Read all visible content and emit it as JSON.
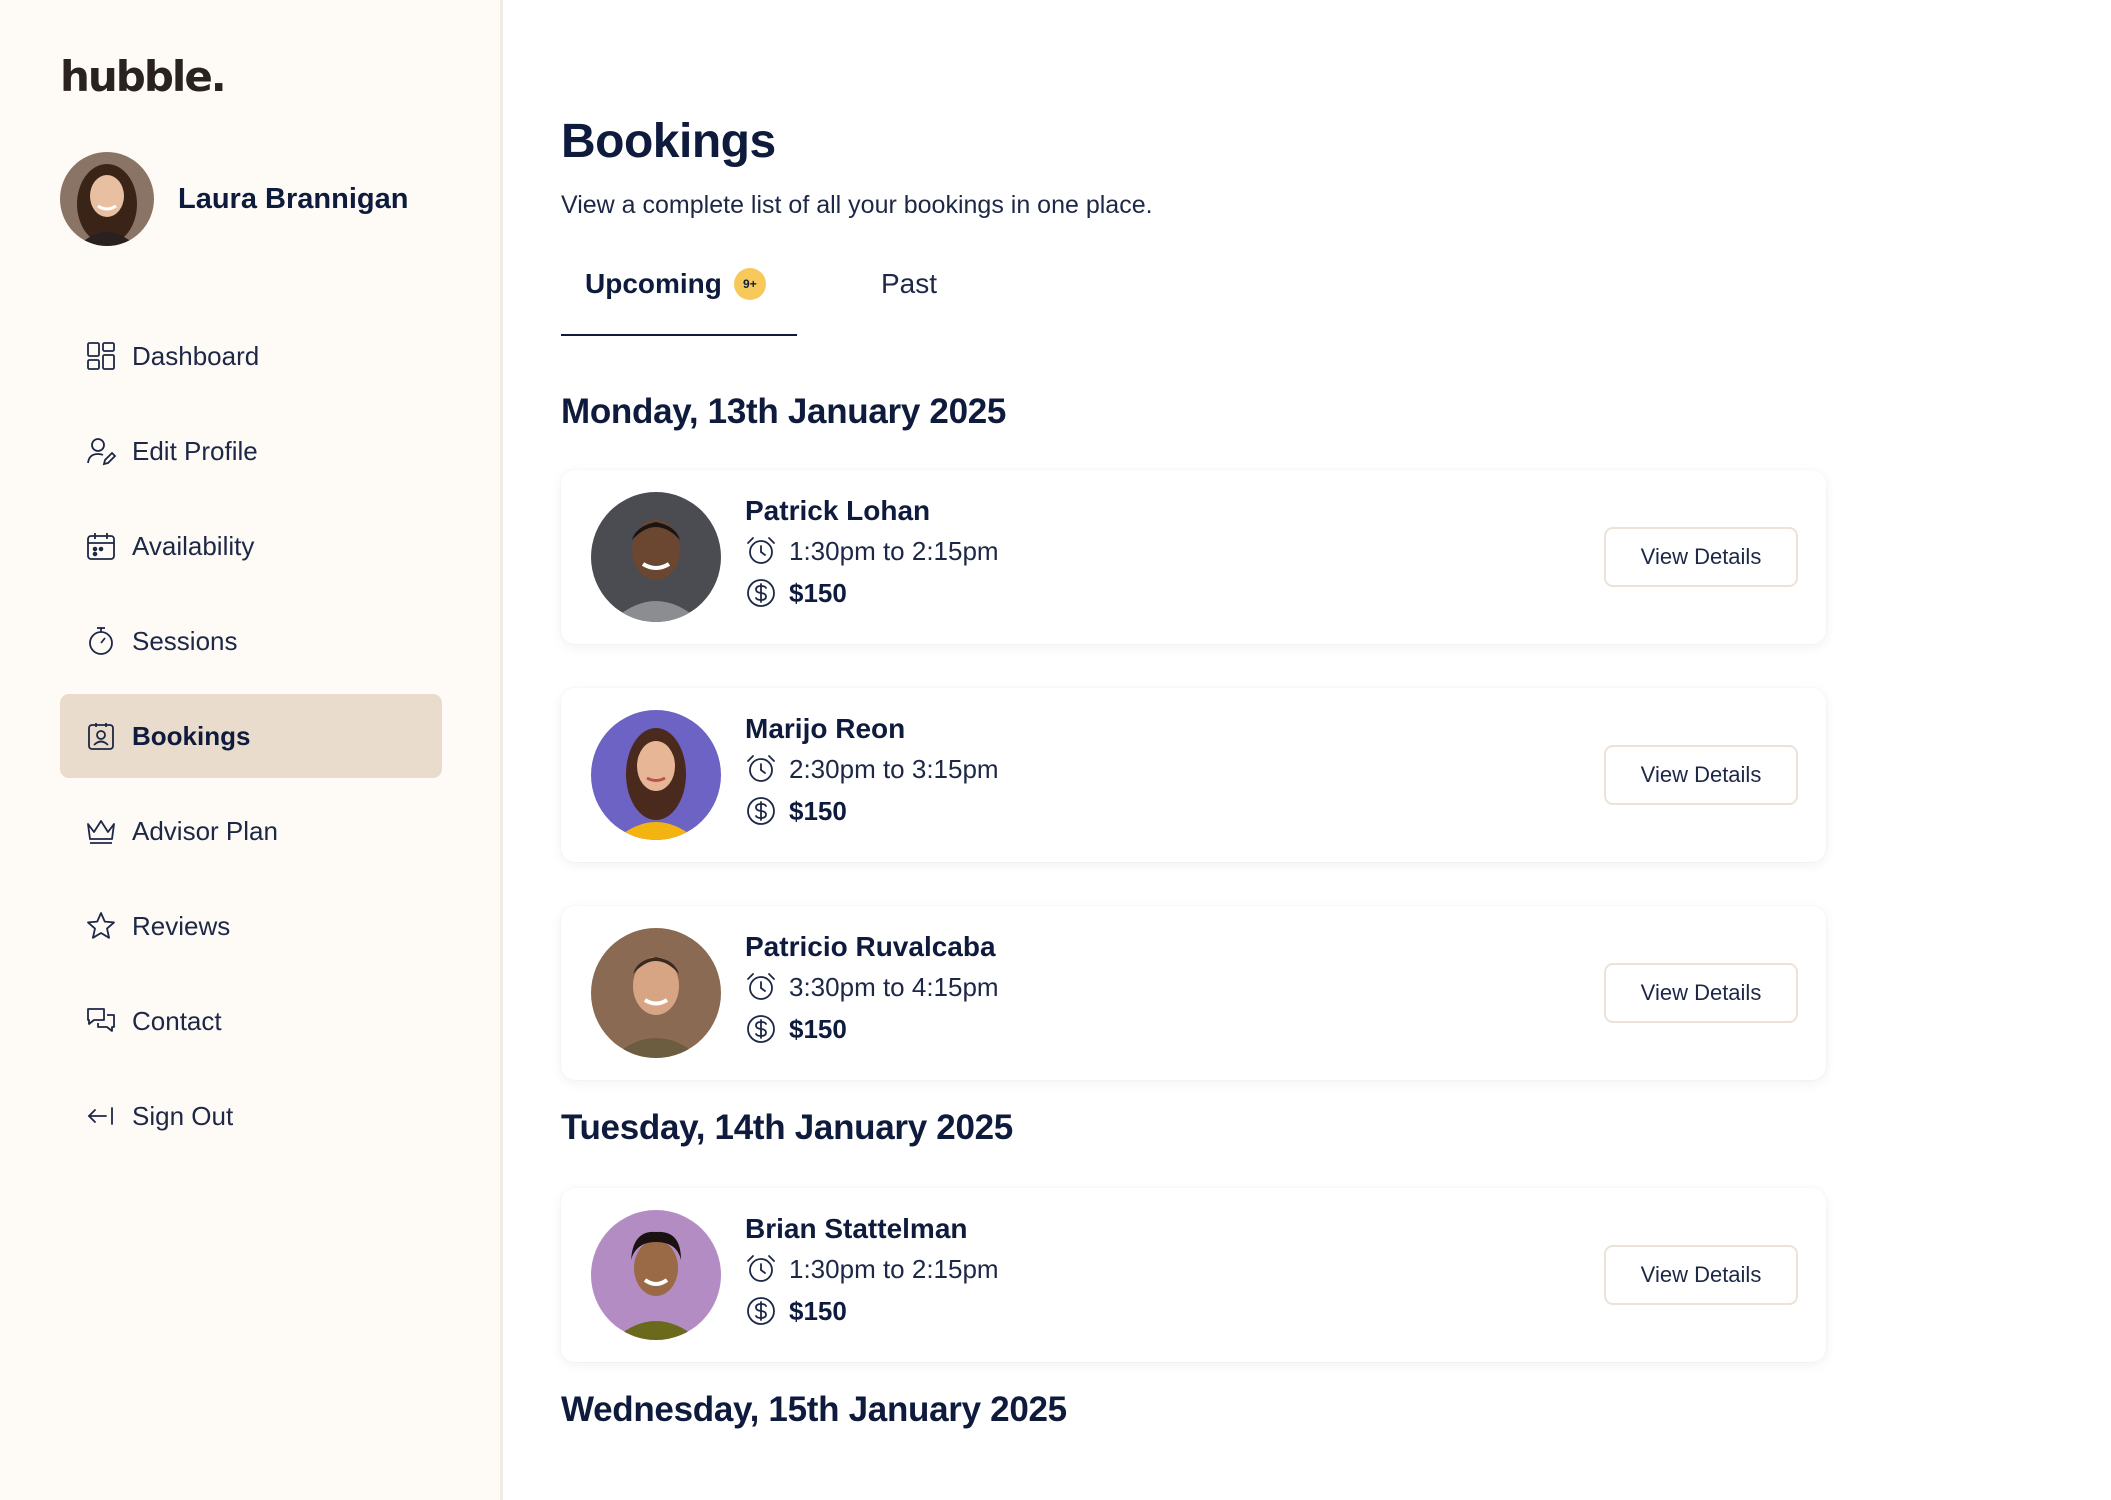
{
  "sidebar": {
    "logo": "hubble.",
    "user_name": "Laura Brannigan",
    "items": [
      {
        "label": "Dashboard",
        "icon": "dashboard-icon"
      },
      {
        "label": "Edit Profile",
        "icon": "edit-profile-icon"
      },
      {
        "label": "Availability",
        "icon": "calendar-icon"
      },
      {
        "label": "Sessions",
        "icon": "stopwatch-icon"
      },
      {
        "label": "Bookings",
        "icon": "bookings-icon",
        "active": true
      },
      {
        "label": "Advisor Plan",
        "icon": "crown-icon"
      },
      {
        "label": "Reviews",
        "icon": "star-icon"
      },
      {
        "label": "Contact",
        "icon": "chat-icon"
      },
      {
        "label": "Sign Out",
        "icon": "sign-out-icon"
      }
    ]
  },
  "main": {
    "title": "Bookings",
    "subtitle": "View a complete list of all your bookings in one place.",
    "tabs": [
      {
        "label": "Upcoming",
        "badge": "9+",
        "active": true
      },
      {
        "label": "Past"
      }
    ],
    "days": [
      {
        "heading": "Monday, 13th January 2025",
        "bookings": [
          {
            "name": "Patrick Lohan",
            "time": "1:30pm to 2:15pm",
            "price": "$150",
            "button": "View Details"
          },
          {
            "name": "Marijo Reon",
            "time": "2:30pm to 3:15pm",
            "price": "$150",
            "button": "View Details"
          },
          {
            "name": "Patricio Ruvalcaba",
            "time": "3:30pm to 4:15pm",
            "price": "$150",
            "button": "View Details"
          }
        ]
      },
      {
        "heading": "Tuesday, 14th January 2025",
        "bookings": [
          {
            "name": "Brian Stattelman",
            "time": "1:30pm to 2:15pm",
            "price": "$150",
            "button": "View Details"
          }
        ]
      },
      {
        "heading": "Wednesday, 15th January 2025",
        "bookings": []
      }
    ]
  },
  "colors": {
    "sidebar_bg": "#fefbf6",
    "active_nav_bg": "#eadccc",
    "badge": "#f7c95a",
    "text_dark": "#0f1b3c"
  }
}
